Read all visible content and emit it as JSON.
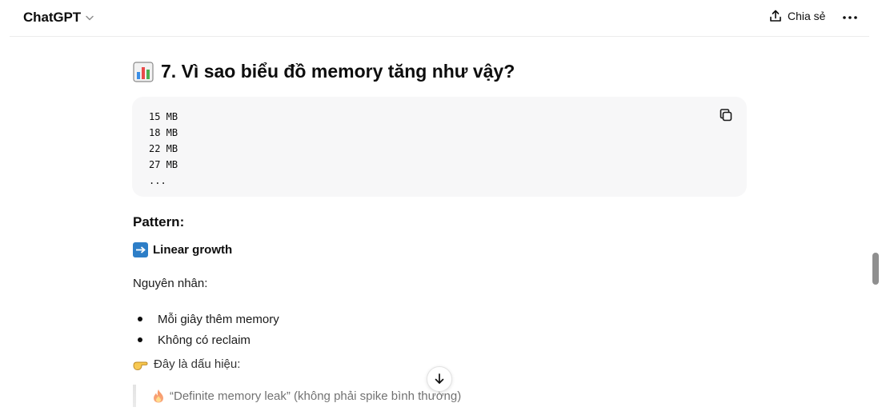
{
  "header": {
    "title": "ChatGPT",
    "title_icon": "chevron-down-icon",
    "share_label": "Chia sẻ",
    "share_icon": "share-icon",
    "more_icon": "more-icon"
  },
  "message": {
    "heading_icon": "bar-chart-icon",
    "heading": "7. Vì sao biểu đồ memory tăng như vậy?",
    "code_lines": [
      "15 MB",
      "18 MB",
      "22 MB",
      "27 MB",
      "..."
    ],
    "copy_icon": "copy-icon",
    "pattern_label": "Pattern:",
    "linear_icon": "right-arrow-icon",
    "linear_label": "Linear growth",
    "cause_label": "Nguyên nhân:",
    "bullets": [
      "Mỗi giây thêm memory",
      "Không có reclaim"
    ],
    "sign_icon": "pointing-hand-icon",
    "sign_text": "Đây là dấu hiệu:",
    "quote_icon": "fire-icon",
    "quote_text": "“Definite memory leak” (không phải spike bình thường)"
  },
  "scroll_down_icon": "arrow-down-icon",
  "colors": {
    "codeblock_bg": "#f7f7f8",
    "arrow_box": "#2d7ec7",
    "scrollbar_thumb": "#8f8f8f"
  }
}
